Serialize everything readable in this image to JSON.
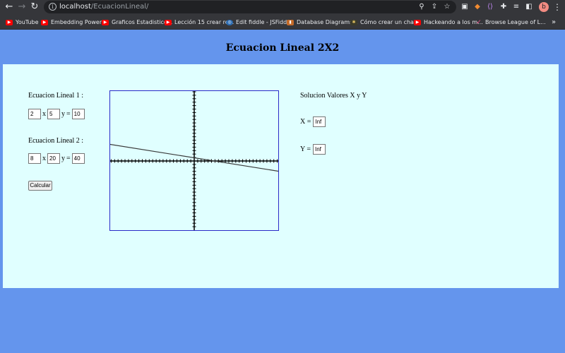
{
  "browser": {
    "url_host": "localhost",
    "url_path": "/EcuacionLineal/",
    "profile_initial": "b",
    "bookmarks": [
      {
        "label": "YouTube",
        "icon": "youtube-icon"
      },
      {
        "label": "Embedding Power...",
        "icon": "youtube-icon"
      },
      {
        "label": "Graficos Estadistico...",
        "icon": "youtube-icon"
      },
      {
        "label": "Lección 15 crear re...",
        "icon": "youtube-icon"
      },
      {
        "label": "Edit fiddle - JSFiddle",
        "icon": "jsfiddle-icon"
      },
      {
        "label": "Database Diagrams...",
        "icon": "bookmark-icon"
      },
      {
        "label": "Cómo crear un chat...",
        "icon": "bookmark-icon"
      },
      {
        "label": "Hackeando a los m...",
        "icon": "youtube-icon"
      },
      {
        "label": "Browse League of L...",
        "icon": "bookmark-icon"
      }
    ],
    "more_bookmarks": "»"
  },
  "page": {
    "title": "Ecuacion Lineal 2X2",
    "eq1": {
      "label": "Ecuacion Lineal 1 :",
      "a": "2",
      "b": "5",
      "c": "10",
      "x_sym": "x",
      "y_sym": "y",
      "eq_sym": "="
    },
    "eq2": {
      "label": "Ecuacion Lineal 2 :",
      "a": "8",
      "b": "20",
      "c": "40",
      "x_sym": "x",
      "y_sym": "y",
      "eq_sym": "="
    },
    "button_label": "Calcular",
    "solution": {
      "title": "Solucion Valores X y Y",
      "x_label": "X =",
      "x_value": "Inf",
      "y_label": "Y =",
      "y_value": "Inf"
    }
  },
  "plot": {
    "line": {
      "color": "#3a3a3a",
      "x1": -12.2,
      "y1": 2.9,
      "x2": 12.2,
      "y2": -1.8
    },
    "axis_range": [
      -12,
      12
    ],
    "axis_color": "#000000",
    "frame_color": "#2a2ac8"
  }
}
